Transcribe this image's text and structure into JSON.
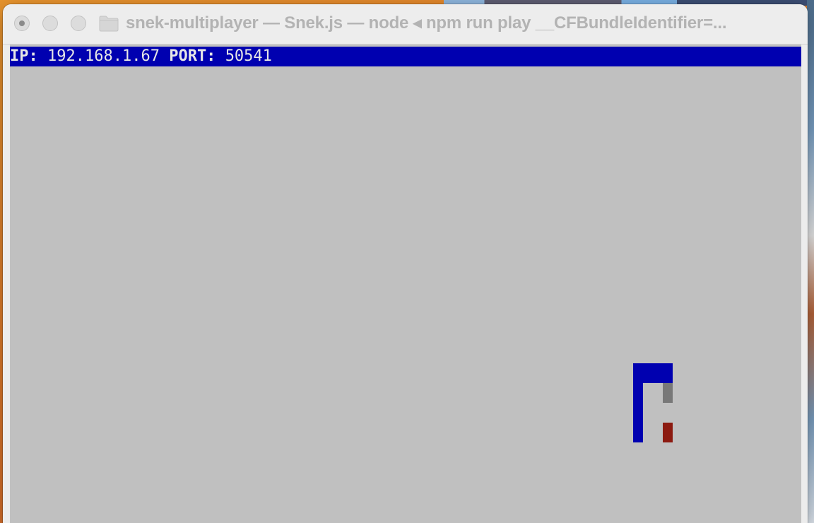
{
  "window": {
    "title": "snek-multiplayer — Snek.js — node ◂ npm run play __CFBundleIdentifier=..."
  },
  "status": {
    "ip_label": "IP:",
    "ip_value": "192.168.1.67",
    "port_label": "PORT:",
    "port_value": "50541"
  },
  "game": {
    "colors": {
      "board": "#c0c0c0",
      "status_bar": "#0000b0",
      "snake": "#0000b0",
      "other_snake": "#787878",
      "food": "#8c1a10"
    },
    "snake_segments": 7,
    "other_snake_segments": 1,
    "food_items": 1
  }
}
